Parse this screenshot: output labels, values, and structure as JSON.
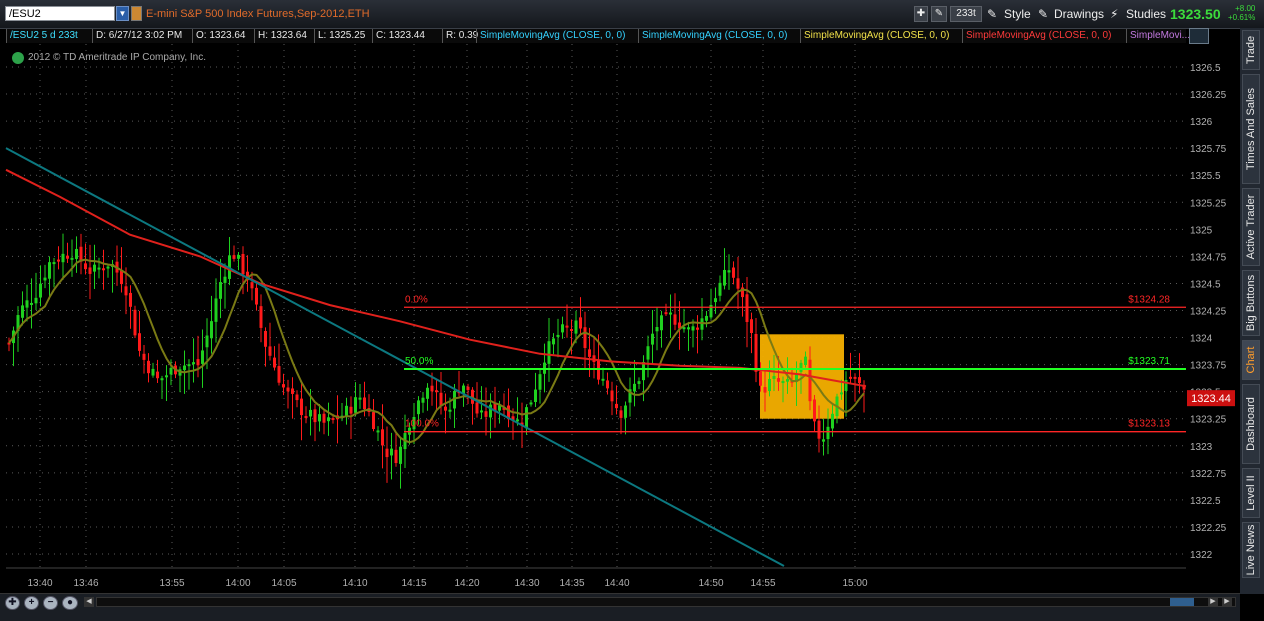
{
  "header": {
    "symbol": "/ESU2",
    "description": "E-mini S&P 500 Index Futures,Sep-2012,ETH",
    "aggregation_button": "233t",
    "style_label": "Style",
    "drawings_label": "Drawings",
    "studies_label": "Studies",
    "last_price": "1323.50",
    "net_change": "+8.00",
    "percent_change": "+0.61%"
  },
  "infobar": {
    "symbol_agg": "/ESU2 5 d 233t",
    "datetime": "D: 6/27/12 3:02 PM",
    "open": "O: 1323.64",
    "high": "H: 1323.64",
    "low": "L: 1325.25",
    "close": "C: 1323.44",
    "range": "R: 0.39",
    "studies": [
      {
        "label": "SimpleMovingAvg (CLOSE, 0, 0)",
        "color": "#35d2ff"
      },
      {
        "label": "SimpleMovingAvg (CLOSE, 0, 0)",
        "color": "#35d2ff"
      },
      {
        "label": "SimpleMovingAvg (CLOSE, 0, 0)",
        "color": "#f0e04a"
      },
      {
        "label": "SimpleMovingAvg (CLOSE, 0, 0)",
        "color": "#ff3b3b"
      },
      {
        "label": "SimpleMovi...",
        "color": "#c37ae0"
      }
    ]
  },
  "copyright": "2012 © TD Ameritrade IP Company, Inc.",
  "sidebar_tabs": [
    "Trade",
    "Times And Sales",
    "Active Trader",
    "Big Buttons",
    "Chart",
    "Dashboard",
    "Level II",
    "Live News"
  ],
  "sidebar_active": "Chart",
  "icons": [
    "gear-icon",
    "zoom-in-icon",
    "zoom-out-icon",
    "crosshair-icon",
    "pencil-icon",
    "magic-wand-icon",
    "scroll-left-icon",
    "scroll-right-icon"
  ],
  "colors": {
    "up_candle": "#1fd11f",
    "down_candle": "#ff1a1a",
    "sma_slow": "#e0211c",
    "sma_fast": "#7a7a14",
    "trendline": "#0c7880",
    "fib_line_red": "#ff2626",
    "fib_line_green": "#22ff22",
    "box_fill": "#f5b000",
    "grid": "#5a5a5a",
    "axis_text": "#b0b0b0",
    "time_text": "#e09020"
  },
  "chart_data": {
    "type": "candlestick",
    "y_ticks": [
      "1326.5",
      "1326.25",
      "1326",
      "1325.75",
      "1325.5",
      "1325.25",
      "1325",
      "1324.75",
      "1324.5",
      "1324.25",
      "1324",
      "1323.75",
      "1323.5",
      "1323.25",
      "1323",
      "1322.75",
      "1322.5",
      "1322.25",
      "1322"
    ],
    "ylim": [
      1321.95,
      1326.55
    ],
    "x_ticks": [
      "13:40",
      "13:46",
      "13:55",
      "14:00",
      "14:05",
      "14:10",
      "14:15",
      "14:20",
      "14:30",
      "14:35",
      "14:40",
      "14:50",
      "14:55",
      "15:00"
    ],
    "current_price_label": "1323.44",
    "fib_levels": [
      {
        "label": "0.0%",
        "value": 1324.28,
        "price_label": "$1324.28"
      },
      {
        "label": "50.0%",
        "value": 1323.71,
        "price_label": "$1323.71"
      },
      {
        "label": "100.0%",
        "value": 1323.13,
        "price_label": "$1323.13"
      }
    ],
    "highlight_box": {
      "x_start": "14:55",
      "x_end": "15:00",
      "y_low": 1323.25,
      "y_high": 1324.03
    },
    "trendline": {
      "start_value": 1325.75,
      "end_value": 1321.9
    }
  }
}
